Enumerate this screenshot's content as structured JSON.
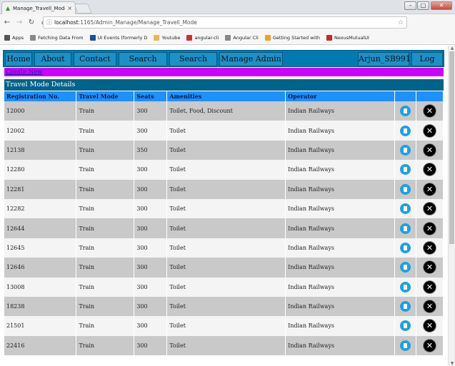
{
  "browser": {
    "tab_title": "Manage_Travell_Mode - ",
    "tab_close": "×",
    "url_host": "localhost",
    "url_rest": ":1165/Admin_Manage/Manage_Travell_Mode",
    "bookmarks": [
      {
        "label": "Apps",
        "icon": "apps-icon",
        "color": "#555555"
      },
      {
        "label": "Fetching Data From",
        "icon": "page-icon",
        "color": "#888888"
      },
      {
        "label": "UI Events (formerly D",
        "icon": "w3-icon",
        "color": "#1a4fa0"
      },
      {
        "label": "Youtube",
        "icon": "folder-icon",
        "color": "#e8b84a"
      },
      {
        "label": "angular-cli",
        "icon": "bookmark-red-icon",
        "color": "#d32f2f"
      },
      {
        "label": "Angular Cli",
        "icon": "page-icon",
        "color": "#888888"
      },
      {
        "label": "Getting Started with",
        "icon": "sparkle-icon",
        "color": "#f4a020"
      },
      {
        "label": "NexusMutualUI",
        "icon": "angular-icon",
        "color": "#c62828"
      }
    ]
  },
  "nav": {
    "home": "Home",
    "about": "About Us",
    "contact": "Contact Us",
    "search_ticket": "Search Ticket",
    "search_hotel": "Search Hotel",
    "manage_admin": "Manage Admin",
    "user": "Arjun_SB991",
    "logout": "Log Out"
  },
  "create_new": "Create New",
  "section_title": "Travel Mode Details",
  "table": {
    "headers": [
      "Registration No.",
      "Travel Mode",
      "Seats",
      "Amenities",
      "Operator"
    ],
    "rows": [
      [
        "12000",
        "Train",
        "300",
        "Toilet, Food, Discount",
        "Indian Railways"
      ],
      [
        "12002",
        "Train",
        "300",
        "Toilet",
        "Indian Railways"
      ],
      [
        "12138",
        "Train",
        "350",
        "Toilet",
        "Indian Railways"
      ],
      [
        "12280",
        "Train",
        "300",
        "Toilet",
        "Indian Railways"
      ],
      [
        "12281",
        "Train",
        "300",
        "Toilet",
        "Indian Railways"
      ],
      [
        "12282",
        "Train",
        "300",
        "Toilet",
        "Indian Railways"
      ],
      [
        "12644",
        "Train",
        "300",
        "Toilet",
        "Indian Railways"
      ],
      [
        "12645",
        "Train",
        "300",
        "Toilet",
        "Indian Railways"
      ],
      [
        "12646",
        "Train",
        "300",
        "Toilet",
        "Indian Railways"
      ],
      [
        "13008",
        "Train",
        "300",
        "Toilet",
        "Indian Railways"
      ],
      [
        "18238",
        "Train",
        "300",
        "Toilet",
        "Indian Railways"
      ],
      [
        "21501",
        "Train",
        "300",
        "Toilet",
        "Indian Railways"
      ],
      [
        "22416",
        "Train",
        "300",
        "Toilet",
        "Indian Railways"
      ]
    ]
  },
  "colors": {
    "nav_bar": "#007ab0",
    "nav_item": "#1e90c8",
    "create_bar": "#cc00ff",
    "section_bar": "#006389",
    "header_row": "#1e90ff"
  }
}
